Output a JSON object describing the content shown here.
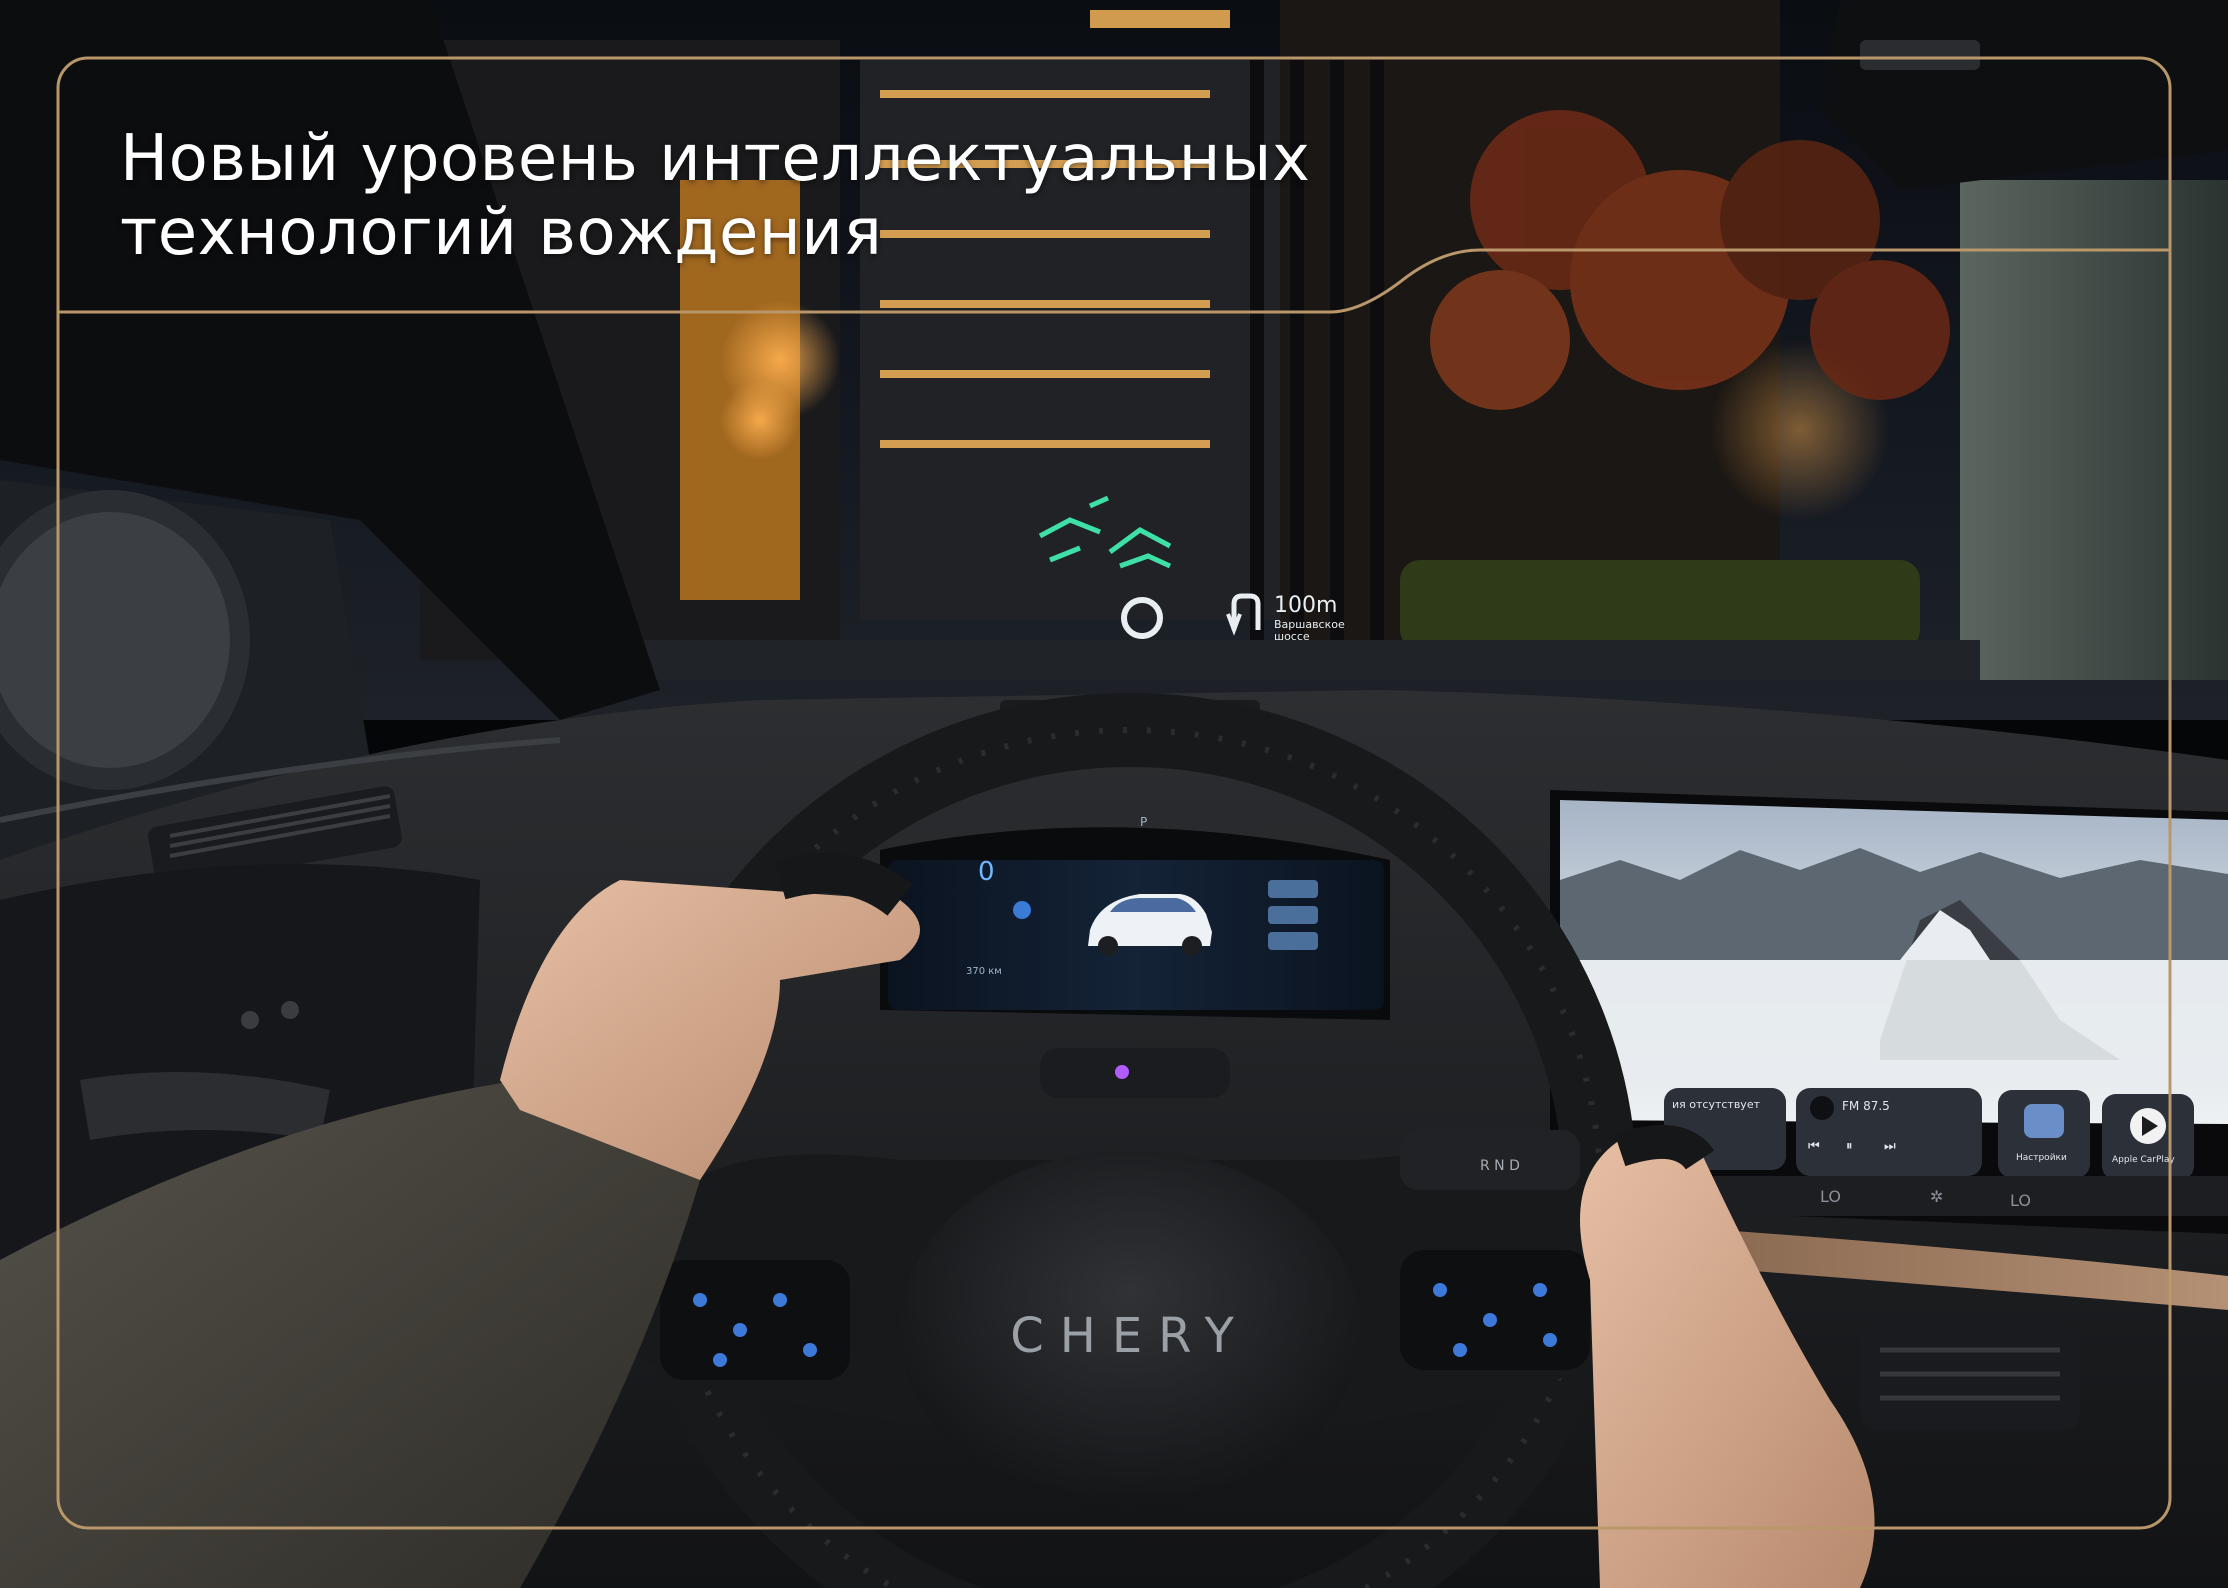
{
  "headline": {
    "line1": "Новый уровень интеллектуальных",
    "line2": "технологий вождения"
  },
  "hud": {
    "speed": "0",
    "distance": "100m",
    "street_line1": "Варшавское",
    "street_line2": "шоссе",
    "color": "#3fe0a8"
  },
  "cluster": {
    "speed": "0",
    "range": "370 км",
    "gear": "P"
  },
  "infotainment": {
    "card_left_text": "ия отсутствует",
    "radio_station": "FM 87.5",
    "settings_label": "Настройки",
    "carplay_label": "Apple CarPlay",
    "climate_left": "LO",
    "climate_right": "LO"
  },
  "steering_wheel": {
    "brand": "CHERY"
  },
  "colors": {
    "frame_gold": "#b9976a",
    "hud_green": "#3fe0a8"
  }
}
